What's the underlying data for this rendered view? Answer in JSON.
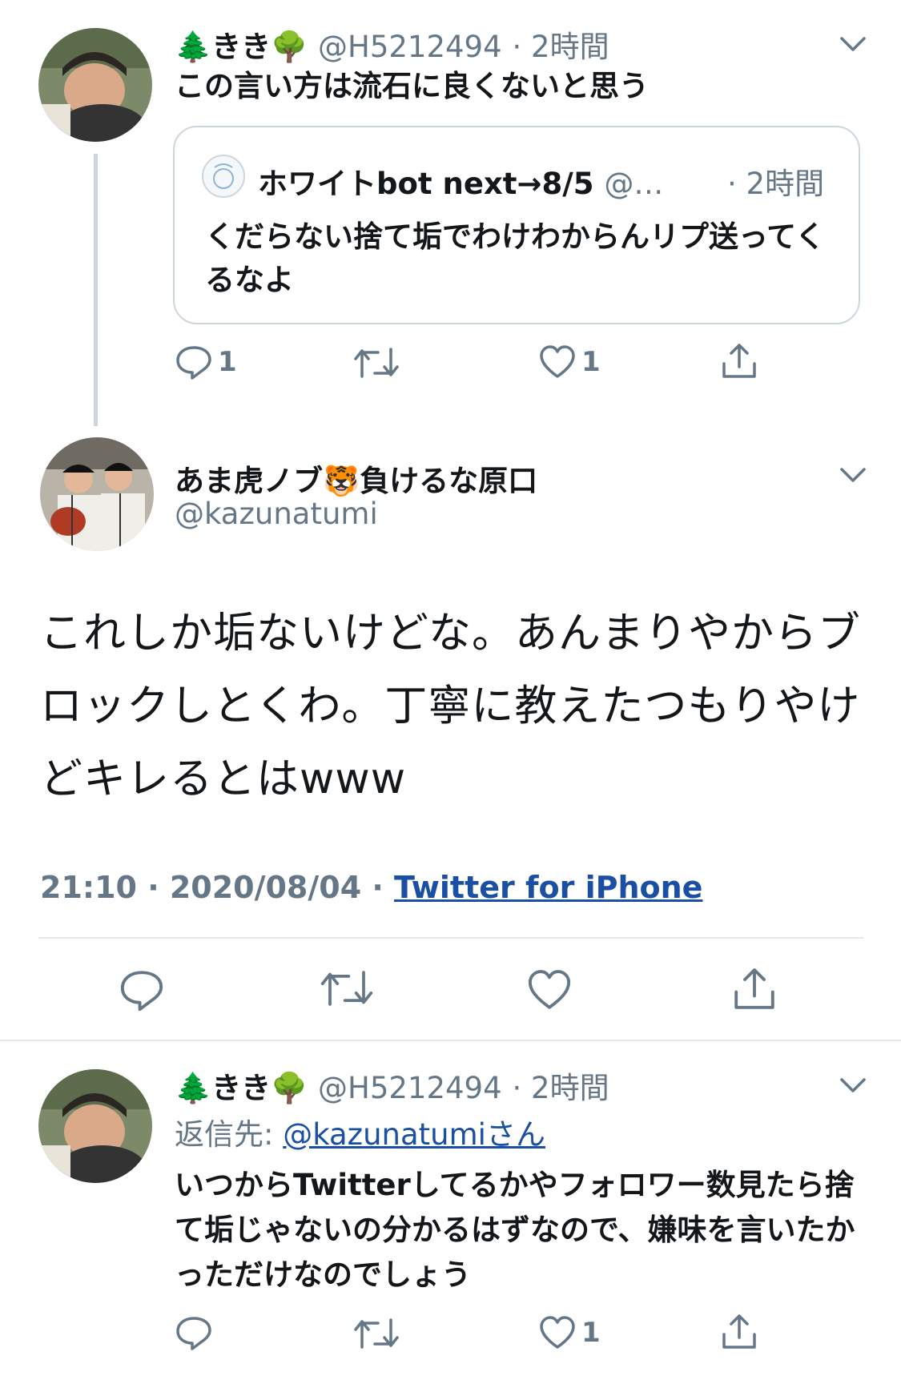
{
  "tweet1": {
    "display_name": "🌲きき🌳",
    "handle": "@H5212494",
    "time": "· 2時間",
    "text": "この言い方は流石に良くないと思う",
    "quote": {
      "display_name": "ホワイトbot next→8/5",
      "handle": "@…",
      "time": "· 2時間",
      "text": "くだらない捨て垢でわけわからんリプ送ってくるなよ"
    },
    "actions": {
      "reply_count": "1",
      "like_count": "1"
    }
  },
  "main": {
    "display_name": "あま虎ノブ🐯負けるな原口",
    "handle": "@kazunatumi",
    "text": "これしか垢ないけどな。あんまりやからブロックしとくわ。丁寧に教えたつもりやけどキレるとはwww",
    "timestamp": "21:10 · 2020/08/04 · ",
    "source": "Twitter for iPhone"
  },
  "reply": {
    "display_name": "🌲きき🌳",
    "handle": "@H5212494",
    "time": "· 2時間",
    "replying_prefix": "返信先: ",
    "replying_to": "@kazunatumiさん",
    "text": "いつからTwitterしてるかやフォロワー数見たら捨て垢じゃないの分かるはずなので、嫌味を言いたかっただけなのでしょう",
    "actions": {
      "like_count": "1"
    }
  },
  "icons": [
    "chevron-down-icon",
    "reply-icon",
    "retweet-icon",
    "like-icon",
    "share-icon"
  ],
  "colors": {
    "link": "#1b4fa3",
    "muted": "#657786",
    "border": "#ccd6dd"
  }
}
